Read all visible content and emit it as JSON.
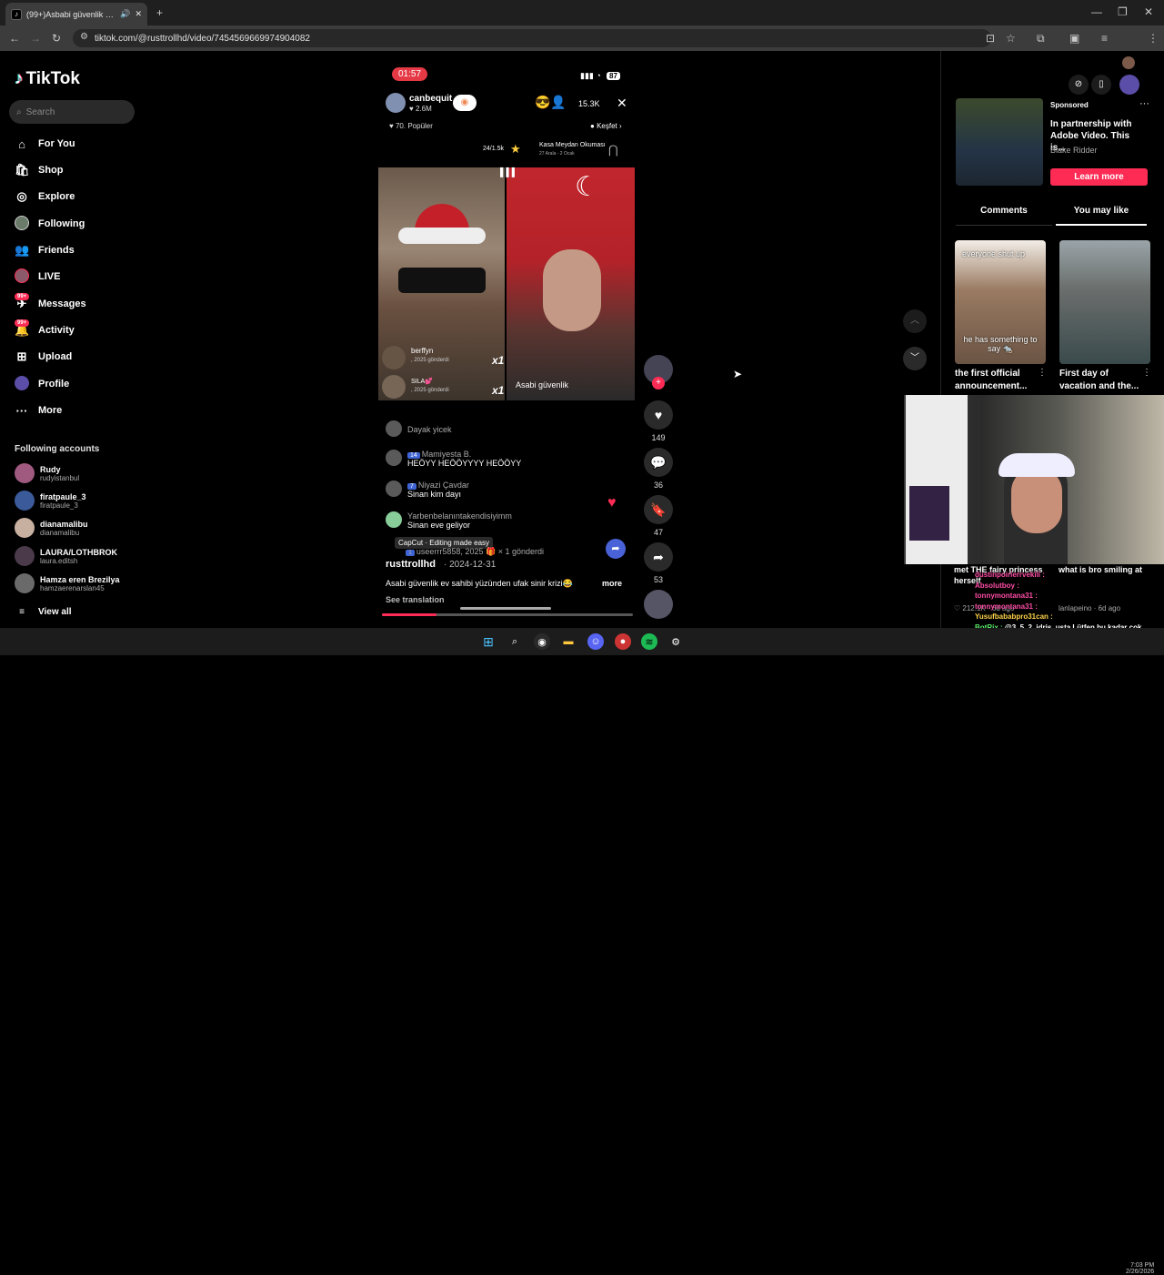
{
  "browser": {
    "tab_title": "(99+)Asbabi güvenlik ev sahi",
    "url": "tiktok.com/@rusttrollhd/video/7454569669974904082"
  },
  "sidebar": {
    "brand": "TikTok",
    "search_placeholder": "Search",
    "nav": [
      {
        "label": "For You",
        "icon": "home-icon"
      },
      {
        "label": "Shop",
        "icon": "shop-icon"
      },
      {
        "label": "Explore",
        "icon": "compass-icon"
      },
      {
        "label": "Following",
        "icon": "following-avatar-icon"
      },
      {
        "label": "Friends",
        "icon": "friends-icon"
      },
      {
        "label": "LIVE",
        "icon": "live-avatar-icon"
      },
      {
        "label": "Messages",
        "icon": "messages-icon",
        "badge": "99+"
      },
      {
        "label": "Activity",
        "icon": "activity-icon",
        "badge": "99+"
      },
      {
        "label": "Upload",
        "icon": "upload-icon"
      },
      {
        "label": "Profile",
        "icon": "profile-icon"
      },
      {
        "label": "More",
        "icon": "more-icon"
      }
    ],
    "following_title": "Following accounts",
    "accounts": [
      {
        "name": "Rudy",
        "handle": "rudyistanbul"
      },
      {
        "name": "firatpaule_3",
        "handle": "firatpaule_3"
      },
      {
        "name": "dianamalibu",
        "handle": "dianamalibu"
      },
      {
        "name": "LAURA/LOTHBROK",
        "handle": "laura.editsh"
      },
      {
        "name": "Hamza eren Brezilya",
        "handle": "hamzaerenarslan45"
      }
    ],
    "view_all": "View all"
  },
  "video": {
    "timer": "01:57",
    "battery": "87",
    "host": "canbequit",
    "host_likes": "♥ 2.6M",
    "viewers": "15.3K",
    "rank": "70. Popüler",
    "discover": "Keşfet",
    "progress_count": "24/1.5k",
    "event_title": "Kasa Meydan Okuması",
    "event_date": "27 Arala - 2 Ocak",
    "gift_user1": "berffyn",
    "gift_user1_sub": ", 2025 gönderdi",
    "gift_user2": "SILA💕",
    "gift_user2_sub": ", 2025 gönderdi",
    "gift_mult": "x1",
    "guest_label": "Asabi güvenlik",
    "chat": [
      {
        "user": "Dayak yicek",
        "level": "",
        "text": ""
      },
      {
        "user": "Mamiyesta B.",
        "level": "14",
        "text": "HEÖYY HEÖÖYYYY HEÖÖYY"
      },
      {
        "user": "Niyazi Çavdar",
        "level": "7",
        "text": "Sinan kim dayı"
      },
      {
        "user": "Yarbenbelanıntakendisiyimm",
        "level": "",
        "text": "Sinan eve geliyor"
      }
    ],
    "gift_line_user": "useerrr5858, 2025",
    "gift_line_text": "× 1 gönderdi",
    "capcut": "CapCut · Editing made easy",
    "author": "rusttrollhd",
    "date": "· 2024-12-31",
    "caption": "Asabi güvenlik ev sahibi yüzünden ufak sinir krizi😂",
    "more": "more",
    "see_translation": "See translation",
    "actions": {
      "likes": "149",
      "comments": "36",
      "saves": "47",
      "shares": "53"
    }
  },
  "right": {
    "sponsored": "Sponsored",
    "ad_title": "In partnership with Adobe Video. This is...",
    "ad_author": "Blake Ridder",
    "learn_more": "Learn more",
    "tabs": [
      "Comments",
      "You may like"
    ],
    "videos": [
      {
        "title": "the first official announcement...",
        "overlay_top": "everyone shut up",
        "overlay_bottom": "he has something to say 🐀"
      },
      {
        "title": "First day of vacation and the..."
      }
    ],
    "under_cam": [
      {
        "title": "met THE fairy princess herself",
        "meta": "♡ 212.1K · 6d ago"
      },
      {
        "title": "what is bro smiling at",
        "meta": "lanlapeino · 6d ago"
      }
    ]
  },
  "stream_chat": [
    {
      "user": "dustinpoirierrvekili :",
      "color": "#ff4da6",
      "text": ""
    },
    {
      "user": "Absolutboy :",
      "color": "#ff4da6",
      "text": ""
    },
    {
      "user": "tonnymontana31 :",
      "color": "#ff4da6",
      "text": ""
    },
    {
      "user": "tonnymontana31 :",
      "color": "#ff4da6",
      "text": ""
    },
    {
      "user": "Yusufbababpro31can :",
      "color": "#ffd54a",
      "text": ""
    },
    {
      "user": "BotRix :",
      "color": "#5bf06a",
      "text": "@3_5_2_idris_usta Lütfen bu kadar çok büyük harf kullanmayın."
    }
  ],
  "taskbar": {
    "time": "7:03 PM",
    "date": "2/26/2026"
  }
}
